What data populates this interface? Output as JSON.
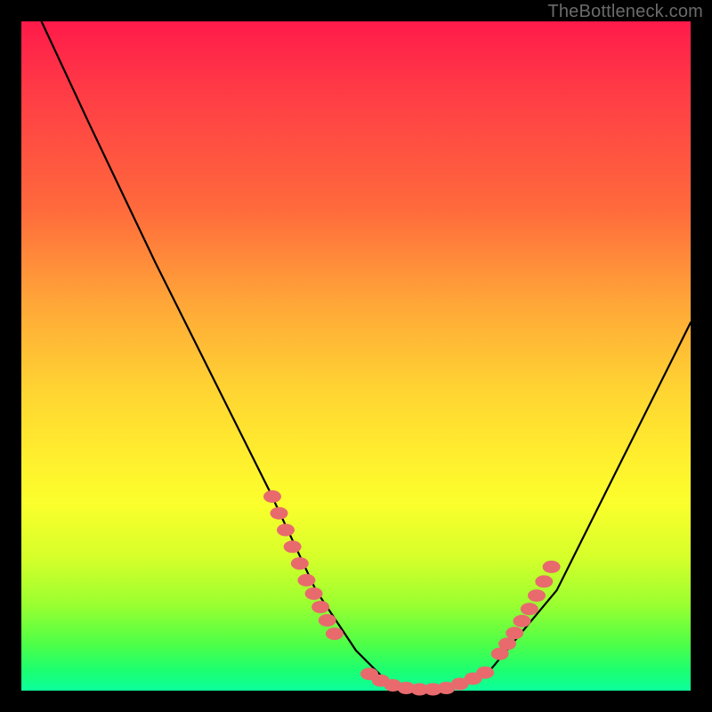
{
  "watermark": "TheBottleneck.com",
  "chart_data": {
    "type": "line",
    "title": "",
    "xlabel": "",
    "ylabel": "",
    "xlim": [
      0,
      100
    ],
    "ylim": [
      0,
      100
    ],
    "grid": false,
    "series": [
      {
        "name": "curve",
        "color": "#000000",
        "x": [
          3,
          10,
          20,
          30,
          37,
          44,
          50,
          55,
          60,
          65,
          70,
          80,
          90,
          100
        ],
        "y": [
          100,
          85,
          64,
          44,
          30,
          15,
          6,
          1,
          0,
          0.5,
          3,
          15,
          35,
          55
        ]
      }
    ],
    "markers": [
      {
        "name": "left-cluster",
        "color": "#e86a6d",
        "points": [
          [
            37.5,
            29
          ],
          [
            38.5,
            26.5
          ],
          [
            39.5,
            24
          ],
          [
            40.5,
            21.5
          ],
          [
            41.6,
            19
          ],
          [
            42.6,
            16.5
          ],
          [
            43.7,
            14.5
          ],
          [
            44.7,
            12.5
          ],
          [
            45.7,
            10.5
          ],
          [
            46.8,
            8.5
          ]
        ]
      },
      {
        "name": "bottom-cluster",
        "color": "#e86a6d",
        "points": [
          [
            52,
            2.5
          ],
          [
            53.7,
            1.5
          ],
          [
            55.5,
            0.8
          ],
          [
            57.5,
            0.4
          ],
          [
            59.5,
            0.2
          ],
          [
            61.5,
            0.2
          ],
          [
            63.5,
            0.4
          ],
          [
            65.5,
            1.0
          ],
          [
            67.5,
            1.8
          ],
          [
            69.3,
            2.7
          ]
        ]
      },
      {
        "name": "right-cluster",
        "color": "#e86a6d",
        "points": [
          [
            71.5,
            5.5
          ],
          [
            72.6,
            7.0
          ],
          [
            73.7,
            8.6
          ],
          [
            74.8,
            10.4
          ],
          [
            75.9,
            12.2
          ],
          [
            77.0,
            14.2
          ],
          [
            78.1,
            16.3
          ],
          [
            79.2,
            18.5
          ]
        ]
      }
    ]
  }
}
